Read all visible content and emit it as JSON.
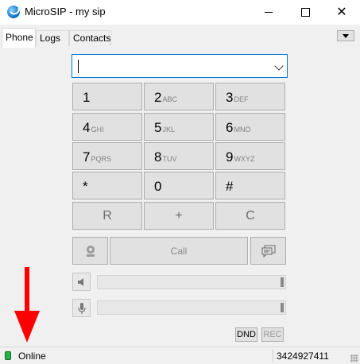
{
  "window": {
    "title": "MicroSIP - my sip"
  },
  "tabs": [
    {
      "label": "Phone",
      "active": true
    },
    {
      "label": "Logs",
      "active": false
    },
    {
      "label": "Contacts",
      "active": false
    }
  ],
  "dialer": {
    "input_value": "",
    "keys": [
      {
        "digit": "1",
        "letters": ""
      },
      {
        "digit": "2",
        "letters": "ABC"
      },
      {
        "digit": "3",
        "letters": "DEF"
      },
      {
        "digit": "4",
        "letters": "GHI"
      },
      {
        "digit": "5",
        "letters": "JKL"
      },
      {
        "digit": "6",
        "letters": "MNO"
      },
      {
        "digit": "7",
        "letters": "PQRS"
      },
      {
        "digit": "8",
        "letters": "TUV"
      },
      {
        "digit": "9",
        "letters": "WXYZ"
      },
      {
        "digit": "*",
        "letters": ""
      },
      {
        "digit": "0",
        "letters": ""
      },
      {
        "digit": "#",
        "letters": ""
      }
    ],
    "functions": {
      "redial": "R",
      "plus": "+",
      "clear": "C"
    },
    "call_label": "Call"
  },
  "audio": {
    "speaker_level": 1.0,
    "mic_level": 1.0
  },
  "buttons": {
    "dnd": "DND",
    "rec": "REC"
  },
  "status": {
    "text": "Online",
    "number": "3424927411",
    "led_color": "#27b14a"
  },
  "colors": {
    "focus_border": "#0078d7",
    "annotation_arrow": "#ff0000"
  }
}
